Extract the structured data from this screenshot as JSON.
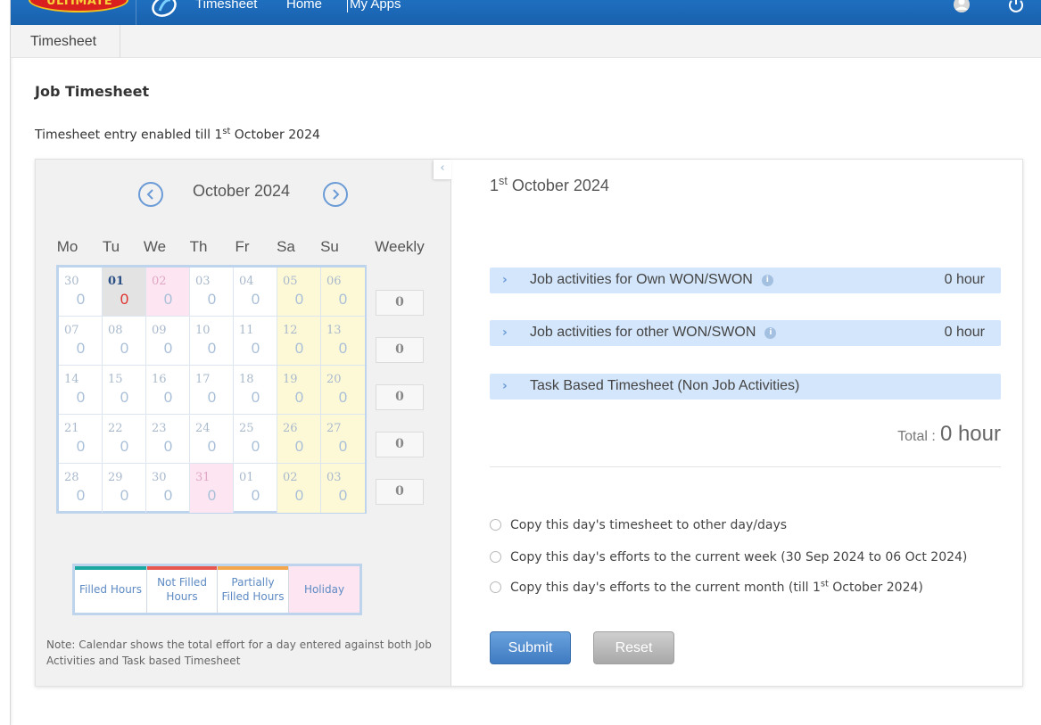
{
  "nav": {
    "logo_text": "ULTIMATE",
    "app_name": "Timesheet",
    "home": "Home",
    "my_apps": "My Apps"
  },
  "subnav": {
    "tab": "Timesheet"
  },
  "page": {
    "title": "Job Timesheet",
    "notice_prefix": "Timesheet entry enabled till 1",
    "notice_sup": "st",
    "notice_suffix": " October 2024"
  },
  "calendar": {
    "month_label": "October 2024",
    "days_of_week": [
      "Mo",
      "Tu",
      "We",
      "Th",
      "Fr",
      "Sa",
      "Su"
    ],
    "weekly_header": "Weekly",
    "weeks": [
      {
        "days": [
          {
            "date": "30",
            "value": "0",
            "type": "normal"
          },
          {
            "date": "01",
            "value": "0",
            "type": "today"
          },
          {
            "date": "02",
            "value": "0",
            "type": "holiday"
          },
          {
            "date": "03",
            "value": "0",
            "type": "normal"
          },
          {
            "date": "04",
            "value": "0",
            "type": "normal"
          },
          {
            "date": "05",
            "value": "0",
            "type": "weekend"
          },
          {
            "date": "06",
            "value": "0",
            "type": "weekend"
          }
        ],
        "weekly": "0"
      },
      {
        "days": [
          {
            "date": "07",
            "value": "0",
            "type": "normal"
          },
          {
            "date": "08",
            "value": "0",
            "type": "normal"
          },
          {
            "date": "09",
            "value": "0",
            "type": "normal"
          },
          {
            "date": "10",
            "value": "0",
            "type": "normal"
          },
          {
            "date": "11",
            "value": "0",
            "type": "normal"
          },
          {
            "date": "12",
            "value": "0",
            "type": "weekend"
          },
          {
            "date": "13",
            "value": "0",
            "type": "weekend"
          }
        ],
        "weekly": "0"
      },
      {
        "days": [
          {
            "date": "14",
            "value": "0",
            "type": "normal"
          },
          {
            "date": "15",
            "value": "0",
            "type": "normal"
          },
          {
            "date": "16",
            "value": "0",
            "type": "normal"
          },
          {
            "date": "17",
            "value": "0",
            "type": "normal"
          },
          {
            "date": "18",
            "value": "0",
            "type": "normal"
          },
          {
            "date": "19",
            "value": "0",
            "type": "weekend"
          },
          {
            "date": "20",
            "value": "0",
            "type": "weekend"
          }
        ],
        "weekly": "0"
      },
      {
        "days": [
          {
            "date": "21",
            "value": "0",
            "type": "normal"
          },
          {
            "date": "22",
            "value": "0",
            "type": "normal"
          },
          {
            "date": "23",
            "value": "0",
            "type": "normal"
          },
          {
            "date": "24",
            "value": "0",
            "type": "normal"
          },
          {
            "date": "25",
            "value": "0",
            "type": "normal"
          },
          {
            "date": "26",
            "value": "0",
            "type": "weekend"
          },
          {
            "date": "27",
            "value": "0",
            "type": "weekend"
          }
        ],
        "weekly": "0"
      },
      {
        "days": [
          {
            "date": "28",
            "value": "0",
            "type": "normal"
          },
          {
            "date": "29",
            "value": "0",
            "type": "normal"
          },
          {
            "date": "30",
            "value": "0",
            "type": "normal"
          },
          {
            "date": "31",
            "value": "0",
            "type": "holiday"
          },
          {
            "date": "01",
            "value": "0",
            "type": "normal"
          },
          {
            "date": "02",
            "value": "0",
            "type": "weekend"
          },
          {
            "date": "03",
            "value": "0",
            "type": "weekend"
          }
        ],
        "weekly": "0"
      }
    ]
  },
  "legend": [
    {
      "label": "Filled Hours",
      "color": "#1aa8a0"
    },
    {
      "label": "Not Filled Hours",
      "color": "#e8574f"
    },
    {
      "label": "Partially Filled Hours",
      "color": "#f3a64b"
    },
    {
      "label": "Holiday",
      "color": "#fde6f2"
    }
  ],
  "note": "Note: Calendar shows the total effort for a day entered against both Job Activities and Task based Timesheet",
  "detail": {
    "day_num": "1",
    "day_sup": "st",
    "day_rest": " October 2024",
    "sections": [
      {
        "label": "Job activities for Own WON/SWON",
        "hours": "0 hour",
        "info": true
      },
      {
        "label": "Job activities for other WON/SWON",
        "hours": "0 hour",
        "info": true
      },
      {
        "label": "Task Based Timesheet (Non Job Activities)",
        "hours": "",
        "info": false
      }
    ],
    "total_label": "Total :",
    "total_value": "0 hour",
    "options": {
      "copy_day": "Copy this day's timesheet to other day/days",
      "copy_week": "Copy this day's efforts to the current week (30 Sep 2024 to 06 Oct 2024)",
      "copy_month_prefix": "Copy this day's efforts to the current month (till 1",
      "copy_month_sup": "st",
      "copy_month_suffix": " October 2024)"
    },
    "submit": "Submit",
    "reset": "Reset"
  },
  "colors": {
    "nav_blue": "#1861ad",
    "accent_blue": "#3f7bc2",
    "accordion_bg": "#d4e6fb",
    "weekend_bg": "#fdf9d7",
    "holiday_bg": "#fde6f2",
    "today_value": "#e0312d"
  }
}
